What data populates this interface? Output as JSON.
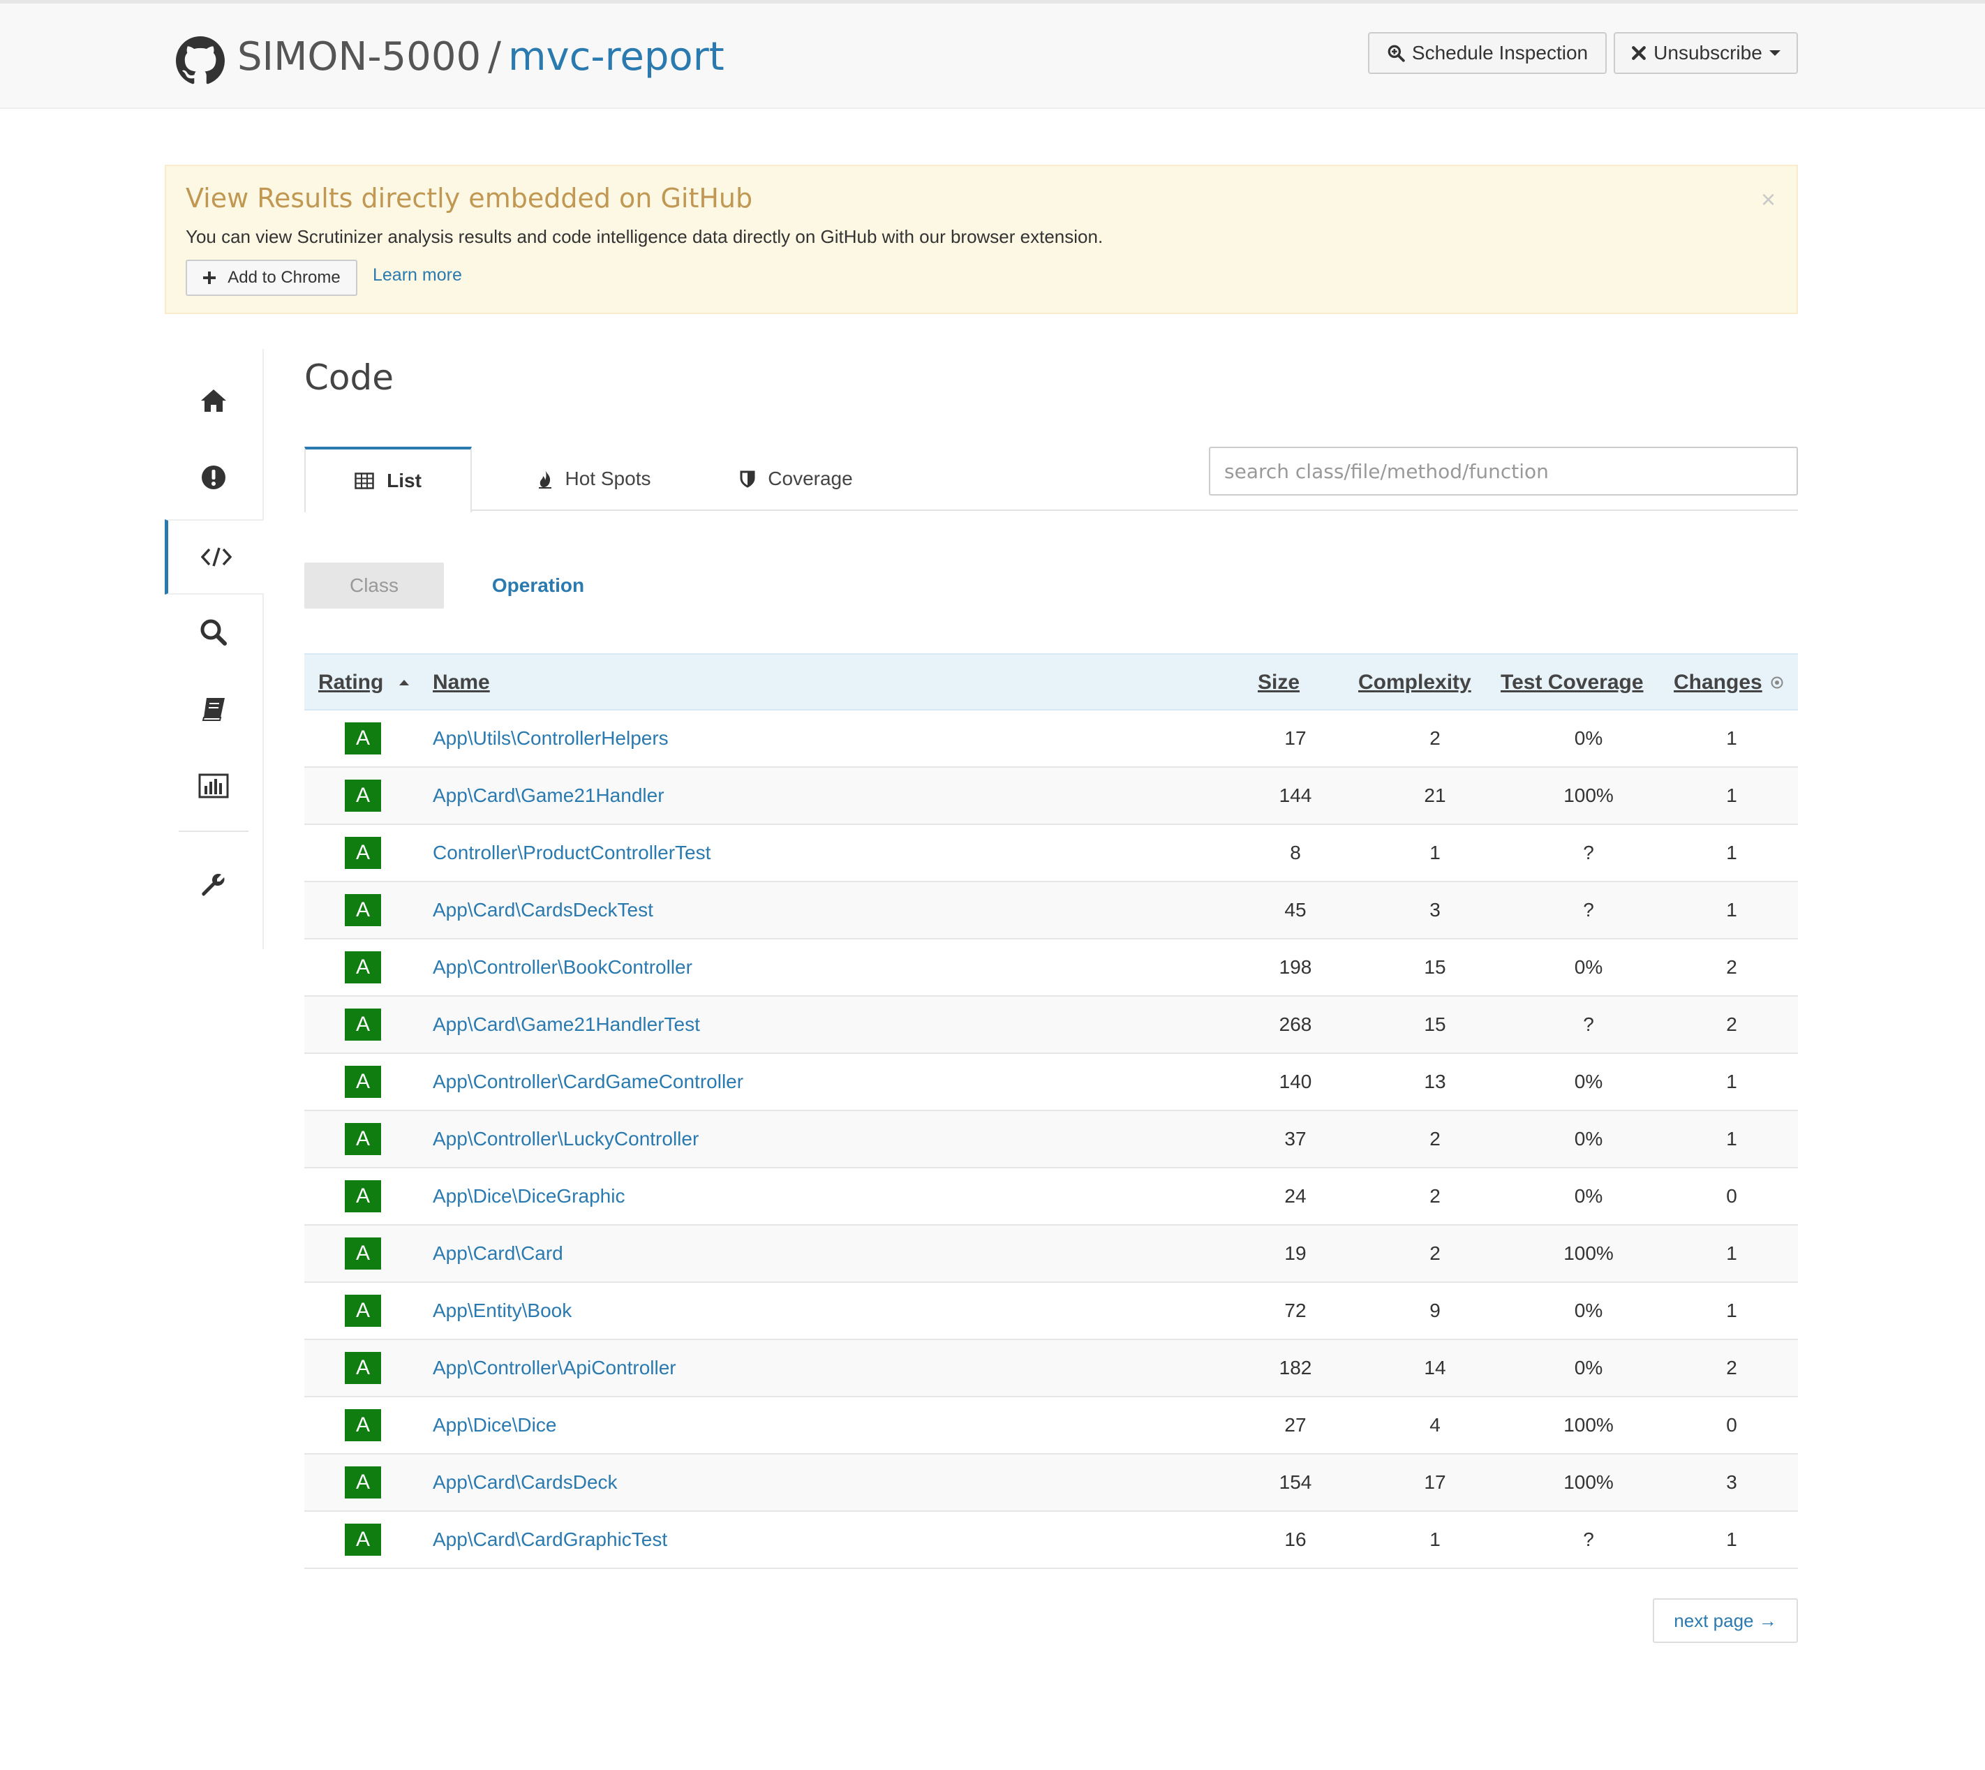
{
  "header": {
    "owner": "SIMON-5000",
    "separator": "/",
    "repo": "mvc-report",
    "schedule_label": "Schedule Inspection",
    "unsubscribe_label": "Unsubscribe"
  },
  "alert": {
    "title": "View Results directly embedded on GitHub",
    "text": "You can view Scrutinizer analysis results and code intelligence data directly on GitHub with our browser extension.",
    "close": "×",
    "add_chrome_label": "Add to Chrome",
    "learn_more_label": "Learn more"
  },
  "sidebar": {
    "items": [
      "home-icon",
      "issues-icon",
      "code-icon",
      "search-icon",
      "book-icon",
      "chart-icon",
      "wrench-icon"
    ],
    "active": "code-icon"
  },
  "page": {
    "title": "Code"
  },
  "tabs": [
    {
      "label": "List",
      "icon": "table-icon"
    },
    {
      "label": "Hot Spots",
      "icon": "fire-icon"
    },
    {
      "label": "Coverage",
      "icon": "shield-icon"
    }
  ],
  "search": {
    "placeholder": "search class/file/method/function"
  },
  "subtabs": {
    "class_label": "Class",
    "operation_label": "Operation"
  },
  "table": {
    "headers": {
      "rating": "Rating",
      "name": "Name",
      "size": "Size",
      "complexity": "Complexity",
      "coverage": "Test Coverage",
      "changes": "Changes"
    },
    "rows": [
      {
        "rating": "A",
        "name": "App\\Utils\\ControllerHelpers",
        "size": "17",
        "complexity": "2",
        "coverage": "0%",
        "changes": "1"
      },
      {
        "rating": "A",
        "name": "App\\Card\\Game21Handler",
        "size": "144",
        "complexity": "21",
        "coverage": "100%",
        "changes": "1"
      },
      {
        "rating": "A",
        "name": "Controller\\ProductControllerTest",
        "size": "8",
        "complexity": "1",
        "coverage": "?",
        "changes": "1"
      },
      {
        "rating": "A",
        "name": "App\\Card\\CardsDeckTest",
        "size": "45",
        "complexity": "3",
        "coverage": "?",
        "changes": "1"
      },
      {
        "rating": "A",
        "name": "App\\Controller\\BookController",
        "size": "198",
        "complexity": "15",
        "coverage": "0%",
        "changes": "2"
      },
      {
        "rating": "A",
        "name": "App\\Card\\Game21HandlerTest",
        "size": "268",
        "complexity": "15",
        "coverage": "?",
        "changes": "2"
      },
      {
        "rating": "A",
        "name": "App\\Controller\\CardGameController",
        "size": "140",
        "complexity": "13",
        "coverage": "0%",
        "changes": "1"
      },
      {
        "rating": "A",
        "name": "App\\Controller\\LuckyController",
        "size": "37",
        "complexity": "2",
        "coverage": "0%",
        "changes": "1"
      },
      {
        "rating": "A",
        "name": "App\\Dice\\DiceGraphic",
        "size": "24",
        "complexity": "2",
        "coverage": "0%",
        "changes": "0"
      },
      {
        "rating": "A",
        "name": "App\\Card\\Card",
        "size": "19",
        "complexity": "2",
        "coverage": "100%",
        "changes": "1"
      },
      {
        "rating": "A",
        "name": "App\\Entity\\Book",
        "size": "72",
        "complexity": "9",
        "coverage": "0%",
        "changes": "1"
      },
      {
        "rating": "A",
        "name": "App\\Controller\\ApiController",
        "size": "182",
        "complexity": "14",
        "coverage": "0%",
        "changes": "2"
      },
      {
        "rating": "A",
        "name": "App\\Dice\\Dice",
        "size": "27",
        "complexity": "4",
        "coverage": "100%",
        "changes": "0"
      },
      {
        "rating": "A",
        "name": "App\\Card\\CardsDeck",
        "size": "154",
        "complexity": "17",
        "coverage": "100%",
        "changes": "3"
      },
      {
        "rating": "A",
        "name": "App\\Card\\CardGraphicTest",
        "size": "16",
        "complexity": "1",
        "coverage": "?",
        "changes": "1"
      }
    ]
  },
  "pagination": {
    "next_label": "next page →"
  },
  "colors": {
    "accent": "#2a7ab0",
    "rating_a": "#0f7d0f",
    "alert_bg": "#fcf8e3",
    "alert_title": "#c09853",
    "table_header_bg": "#e8f3f9"
  }
}
